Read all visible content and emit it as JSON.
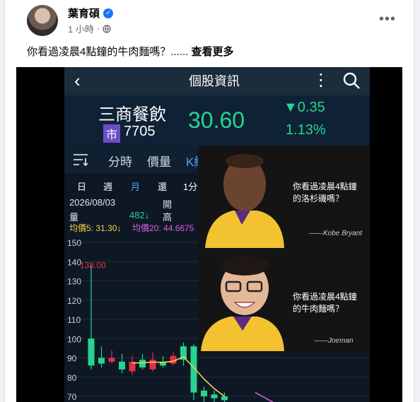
{
  "post": {
    "author": "葉育碩",
    "time": "1 小時",
    "text": "你看過凌晨4點鐘的牛肉麵嗎？......",
    "see_more": "查看更多"
  },
  "app": {
    "title": "個股資訊",
    "stock_name": "三商餐飲",
    "market_badge": "市",
    "code": "7705",
    "price": "30.60",
    "change": "▼0.35",
    "change_pct": "1.13%",
    "accent_green": "#27d48f",
    "tabs": [
      "分時",
      "價量",
      "K線"
    ],
    "periods": [
      "日",
      "週",
      "月",
      "還",
      "1分"
    ],
    "date": "2026/08/03",
    "open_label": "開",
    "high_label": "高",
    "vol_label": "量",
    "vol_value": "482↓",
    "ma5": "均價5: 31.30↓",
    "ma20": "均價20: 44.6675",
    "high_marker": "138.00"
  },
  "meme": {
    "caption1": [
      "你看過凌晨4點鐘",
      "的洛杉磯嗎？"
    ],
    "sig1": "——Kobe Bryant",
    "caption2": [
      "你看過凌晨4點鐘",
      "的牛肉麵嗎？"
    ],
    "sig2": "——Joeman"
  },
  "chart_data": {
    "type": "candlestick",
    "yticks": [
      150,
      140,
      130,
      120,
      110,
      100,
      90,
      80,
      70
    ],
    "candles": [
      {
        "o": 100,
        "c": 86,
        "h": 138,
        "l": 84
      },
      {
        "o": 90,
        "c": 87,
        "h": 96,
        "l": 85
      },
      {
        "o": 88,
        "c": 90,
        "h": 94,
        "l": 87
      },
      {
        "o": 88,
        "c": 84,
        "h": 92,
        "l": 82
      },
      {
        "o": 83,
        "c": 88,
        "h": 91,
        "l": 81
      },
      {
        "o": 89,
        "c": 85,
        "h": 92,
        "l": 84
      },
      {
        "o": 84,
        "c": 89,
        "h": 93,
        "l": 83
      },
      {
        "o": 88,
        "c": 86,
        "h": 91,
        "l": 85
      },
      {
        "o": 87,
        "c": 91,
        "h": 93,
        "l": 86
      },
      {
        "o": 96,
        "c": 89,
        "h": 98,
        "l": 86
      },
      {
        "o": 96,
        "c": 72,
        "h": 97,
        "l": 68
      },
      {
        "o": 73,
        "c": 70,
        "h": 75,
        "l": 67
      },
      {
        "o": 71,
        "c": 69,
        "h": 73,
        "l": 67
      },
      {
        "o": 70,
        "c": 68,
        "h": 72,
        "l": 66
      }
    ],
    "ma": [
      null,
      null,
      null,
      null,
      87.3,
      87.4,
      87.8,
      87.7,
      88.2,
      90.5,
      85,
      79,
      74,
      70
    ]
  }
}
